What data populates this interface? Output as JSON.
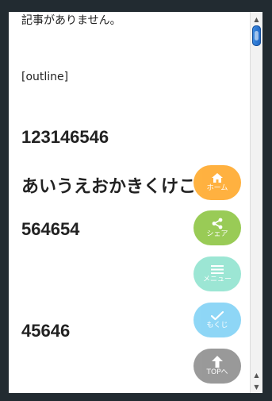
{
  "article": {
    "no_articles_text": "記事がありません。",
    "outline_text": "[outline]",
    "heading_1": "123146546",
    "heading_2": "あいうえおかきくけこ",
    "heading_3": "564654",
    "heading_4": "45646"
  },
  "fab_menu": {
    "home_label": "ホーム",
    "share_label": "シェア",
    "menu_label": "メニュー",
    "toc_label": "もくじ",
    "top_label": "TOPへ"
  },
  "colors": {
    "home": "#ffa726",
    "share": "#8bc43f",
    "menu": "#8fe3cf",
    "toc": "#7fd1f5",
    "top": "#8c8c8c"
  },
  "scrollbar": {
    "up_arrow": "▲",
    "down_arrow": "▼",
    "lower_up_arrow": "▲"
  }
}
